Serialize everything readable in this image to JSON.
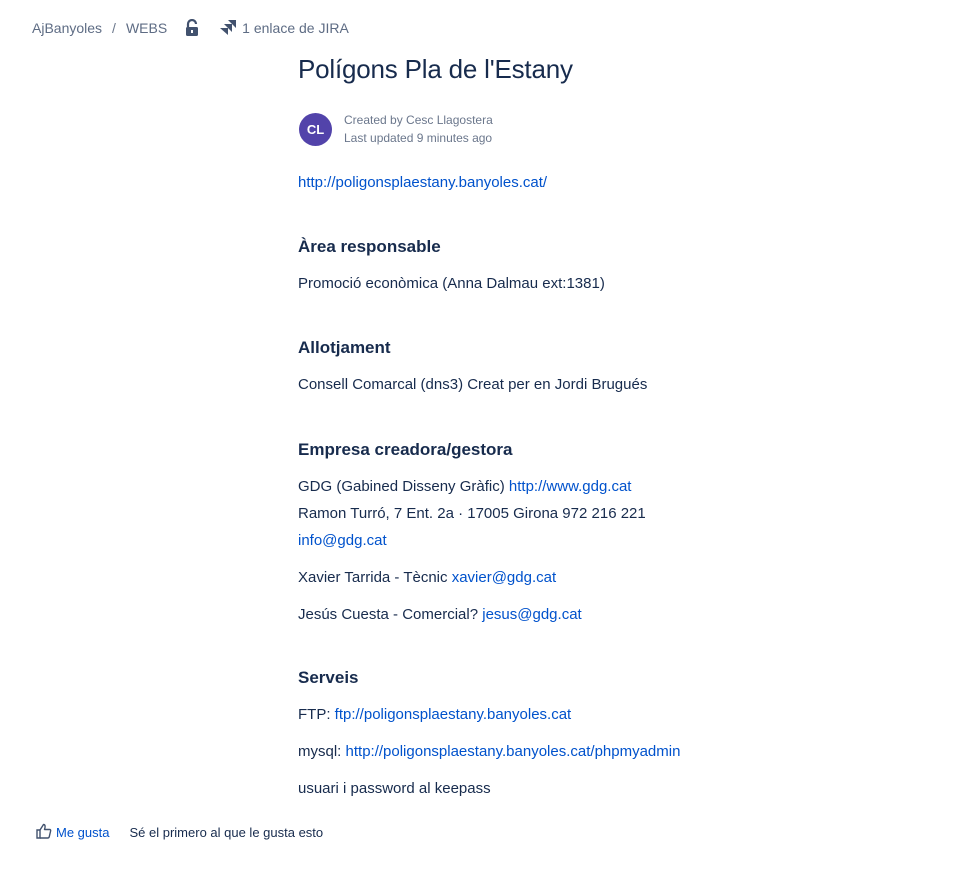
{
  "breadcrumb": {
    "items": [
      "AjBanyoles",
      "WEBS"
    ],
    "separator": "/",
    "jira_label": "1 enlace de JIRA"
  },
  "page": {
    "title": "Polígons Pla de l'Estany",
    "avatar_initials": "CL",
    "avatar_color": "#5243aa",
    "created_by": "Created by Cesc Llagostera",
    "last_updated": "Last updated 9 minutes ago"
  },
  "content": {
    "site_url": "http://poligonsplaestany.banyoles.cat/",
    "area": {
      "heading": "Àrea responsable",
      "text": "Promoció econòmica (Anna Dalmau ext:1381)"
    },
    "hosting": {
      "heading": "Allotjament",
      "text": "Consell Comarcal (dns3) Creat per en Jordi Brugués"
    },
    "company": {
      "heading": "Empresa creadora/gestora",
      "name_text": "GDG (Gabined Disseny Gràfic)",
      "name_link": "http://www.gdg.cat",
      "address": "Ramon Turró, 7 Ent. 2a · 17005 Girona 972 216 221",
      "email": "info@gdg.cat",
      "contact1_text": "Xavier Tarrida - Tècnic",
      "contact1_email": "xavier@gdg.cat",
      "contact2_text": "Jesús Cuesta - Comercial?",
      "contact2_email": "jesus@gdg.cat"
    },
    "services": {
      "heading": "Serveis",
      "ftp_label": "FTP:",
      "ftp_link": "ftp://poligonsplaestany.banyoles.cat",
      "mysql_label": "mysql:",
      "mysql_link": "http://poligonsplaestany.banyoles.cat/phpmyadmin",
      "note": "usuari i password al keepass"
    }
  },
  "footer": {
    "like_label": "Me gusta",
    "like_note": "Sé el primero al que le gusta esto"
  },
  "colors": {
    "link": "#0052cc",
    "text": "#172b4d",
    "meta": "#6b778c"
  }
}
